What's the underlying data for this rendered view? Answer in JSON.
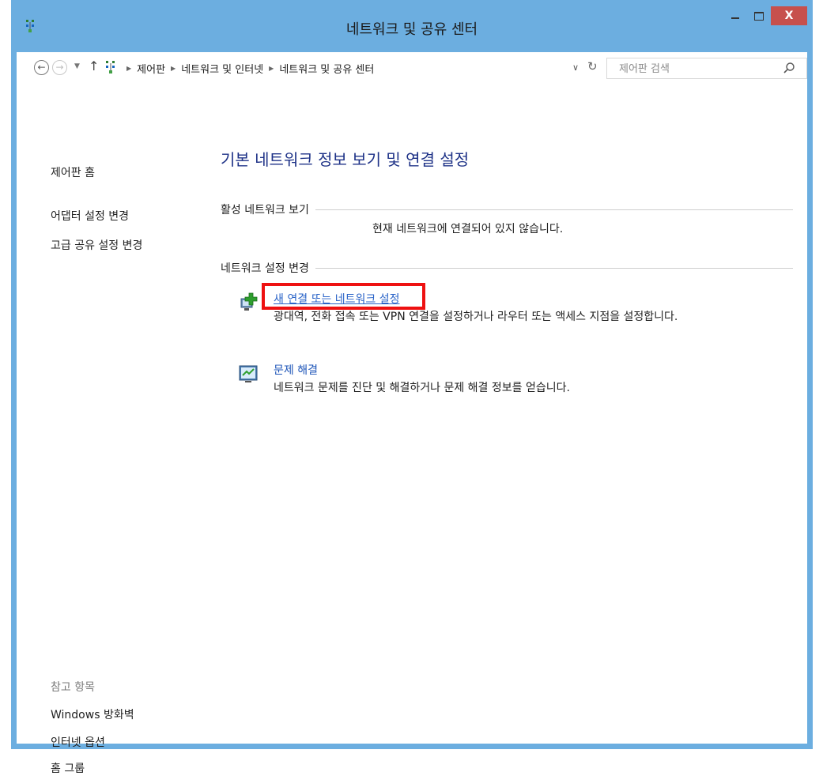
{
  "window": {
    "title": "네트워크 및 공유 센터",
    "close_label": "X"
  },
  "address_bar": {
    "breadcrumbs": [
      "제어판",
      "네트워크 및 인터넷",
      "네트워크 및 공유 센터"
    ],
    "search_placeholder": "제어판 검색"
  },
  "sidebar": {
    "home": "제어판 홈",
    "links": [
      "어댑터 설정 변경",
      "고급 공유 설정 변경"
    ],
    "see_also_header": "참고 항목",
    "see_also": [
      "Windows 방화벽",
      "인터넷 옵션",
      "홈 그룹"
    ]
  },
  "main": {
    "title": "기본 네트워크 정보 보기 및 연결 설정",
    "active_networks": {
      "label": "활성 네트워크 보기",
      "status": "현재 네트워크에 연결되어 있지 않습니다."
    },
    "change_settings": {
      "label": "네트워크 설정 변경",
      "tasks": [
        {
          "link": "새 연결 또는 네트워크 설정",
          "description": "광대역, 전화 접속 또는 VPN 연결을 설정하거나 라우터 또는 액세스 지점을 설정합니다."
        },
        {
          "link": "문제 해결",
          "description": "네트워크 문제를 진단 및 해결하거나 문제 해결 정보를 얻습니다."
        }
      ]
    }
  },
  "colors": {
    "window_frame": "#6caee0",
    "link_blue": "#2b64c8",
    "title_blue": "#1e3287",
    "close_red": "#c7504c",
    "highlight_red": "#ee1111"
  }
}
